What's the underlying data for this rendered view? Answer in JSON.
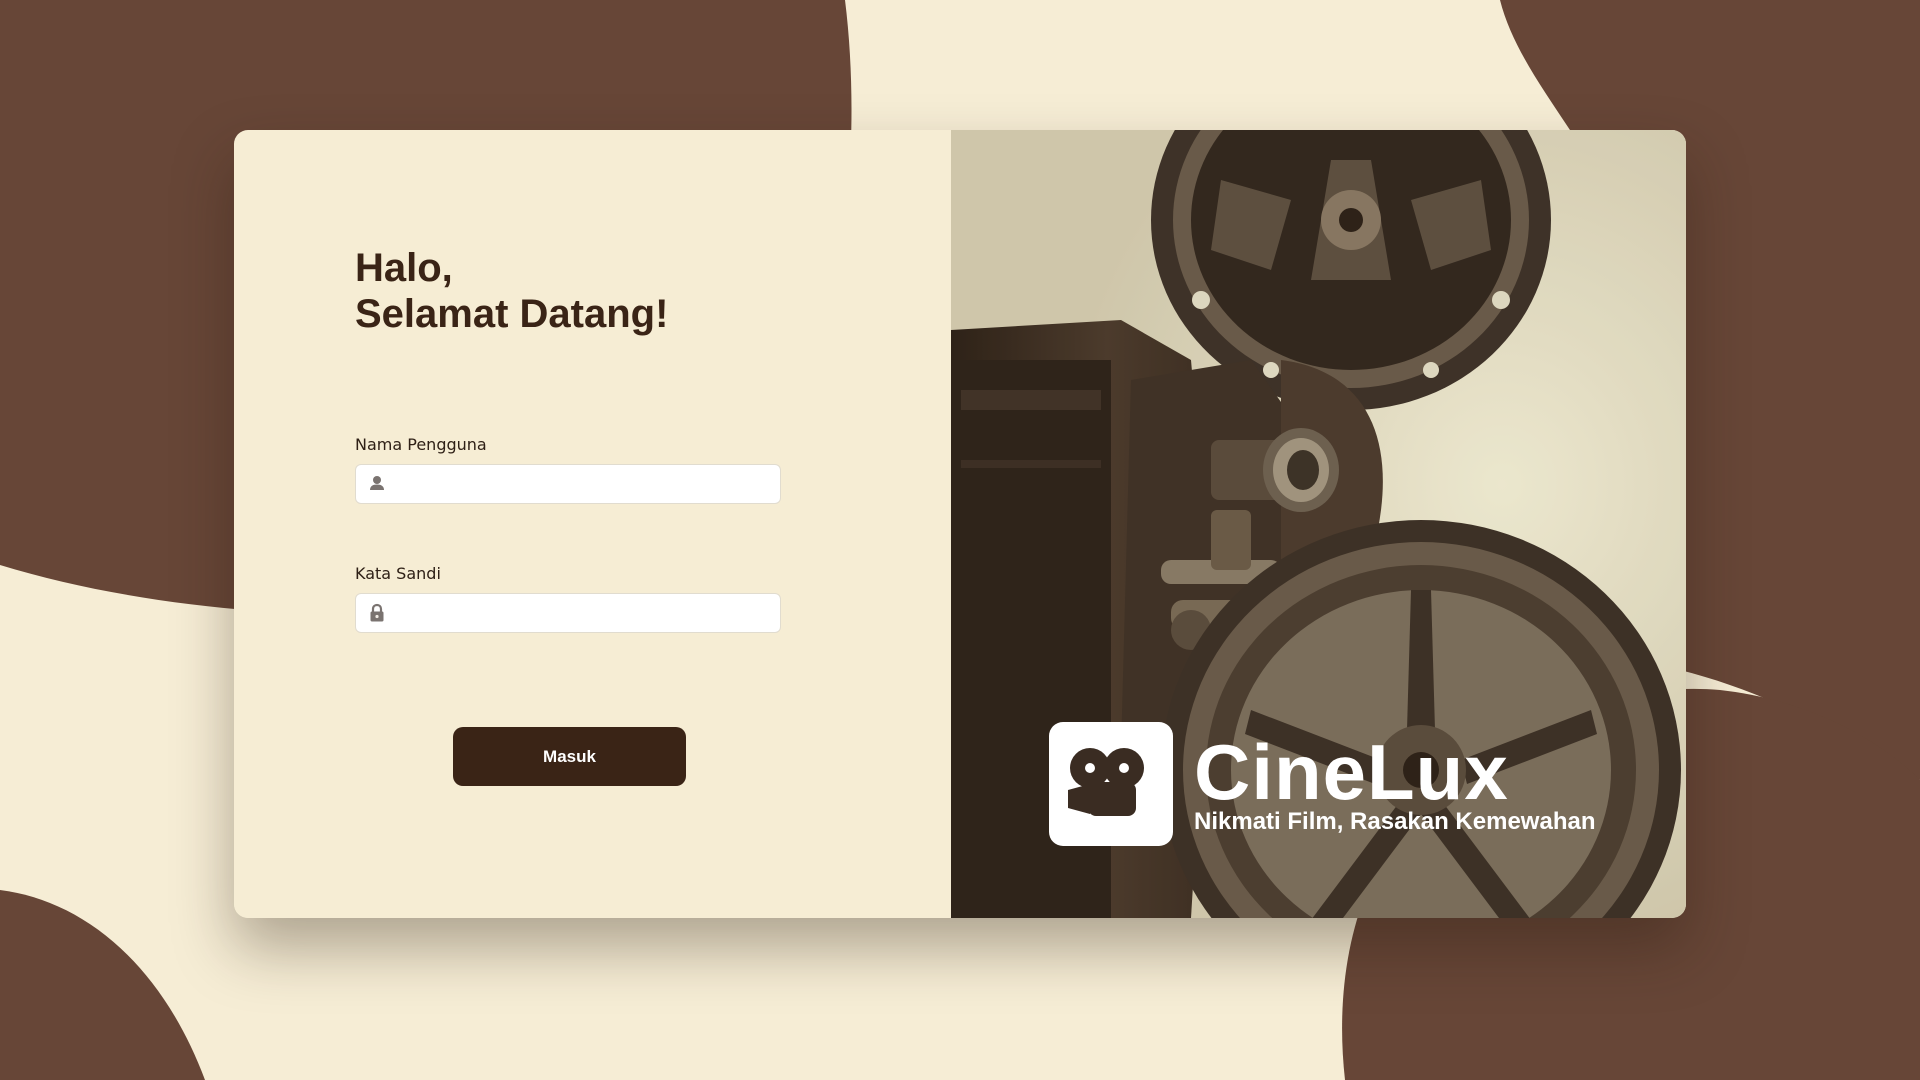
{
  "login": {
    "greeting_line1": "Halo,",
    "greeting_line2": "Selamat Datang!",
    "username": {
      "label": "Nama Pengguna",
      "value": "",
      "placeholder": "",
      "icon": "user-icon"
    },
    "password": {
      "label": "Kata Sandi",
      "value": "",
      "placeholder": "",
      "icon": "lock-icon"
    },
    "submit_label": "Masuk"
  },
  "brand": {
    "name": "CineLux",
    "tagline": "Nikmati Film, Rasakan Kemewahan",
    "logo_icon": "film-camera-icon"
  },
  "colors": {
    "background": "#f6edd5",
    "accent_brown": "#674637",
    "dark_brown": "#3a2416",
    "panel": "#f6edd4"
  }
}
